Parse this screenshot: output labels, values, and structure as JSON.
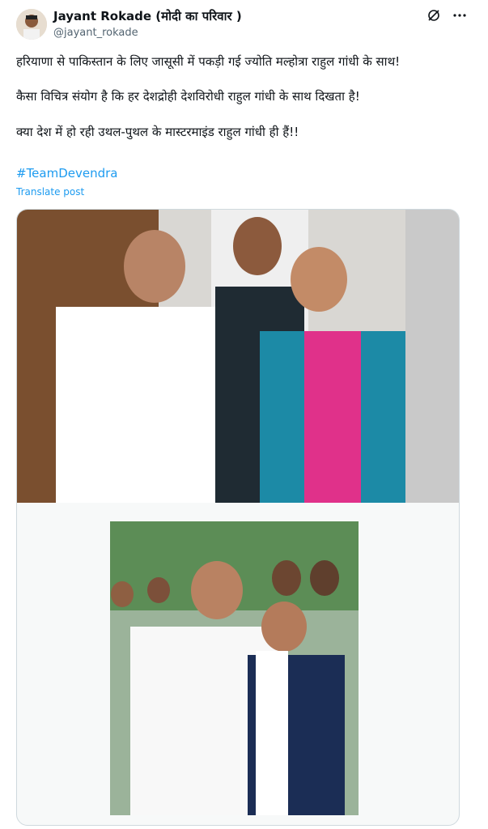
{
  "author": {
    "name": "Jayant Rokade (मोदी का परिवार )",
    "handle": "@jayant_rokade"
  },
  "post": {
    "lines": [
      "हरियाणा से पाकिस्तान के लिए जासूसी में पकड़ी गई ज्योति मल्होत्रा राहुल गांधी के साथ!",
      "कैसा विचित्र संयोग है कि हर देशद्रोही देशविरोधी राहुल गांधी के साथ दिखता है!",
      "क्या देश में हो रही उथल-पुथल के मास्टरमाइंड राहुल गांधी ही हैं!!"
    ],
    "hashtag": "#TeamDevendra",
    "translate_label": "Translate post"
  },
  "icons": {
    "grok": "grok-icon",
    "more": "more-icon"
  }
}
